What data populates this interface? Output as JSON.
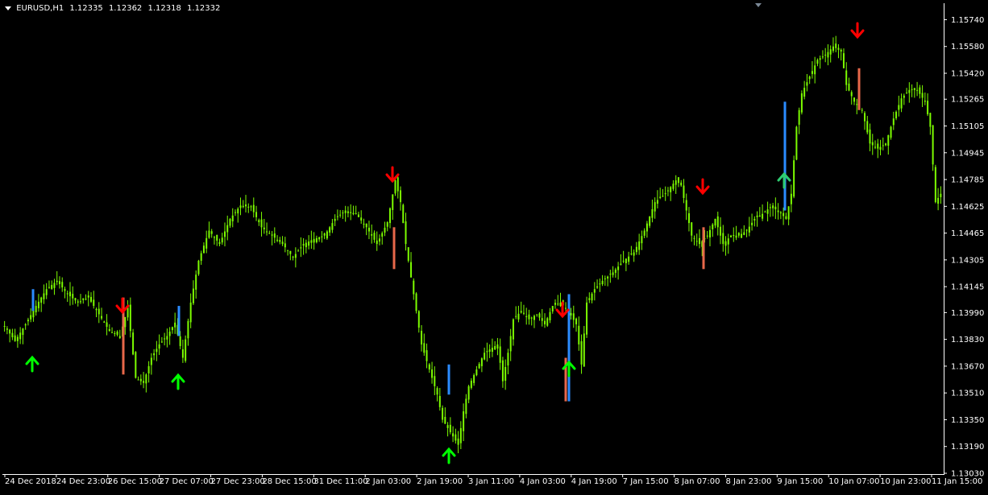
{
  "header": {
    "symbol_timeframe": "EURUSD,H1",
    "quotes": [
      "1.12335",
      "1.12362",
      "1.12318",
      "1.12332"
    ]
  },
  "colors": {
    "background": "#000000",
    "candle": "#7CFC00",
    "axis": "#ffffff",
    "text": "#ffffff",
    "up_arrow": "#00ff00",
    "down_arrow": "#ff0000",
    "bar_red": "#e8684a",
    "bar_blue": "#2b8cff",
    "marker": "#7b8896"
  },
  "chart_data": {
    "type": "candlestick",
    "title": "",
    "xlabel": "",
    "ylabel": "",
    "ylim": [
      1.1303,
      1.158
    ],
    "grid": false,
    "y_ticks": [
      "1.15740",
      "1.15580",
      "1.15420",
      "1.15265",
      "1.15105",
      "1.14945",
      "1.14785",
      "1.14625",
      "1.14465",
      "1.14305",
      "1.14145",
      "1.13990",
      "1.13830",
      "1.13670",
      "1.13510",
      "1.13350",
      "1.13190",
      "1.13030"
    ],
    "x_ticks": [
      "24 Dec 2018",
      "24 Dec 23:00",
      "26 Dec 15:00",
      "27 Dec 07:00",
      "27 Dec 23:00",
      "28 Dec 15:00",
      "31 Dec 11:00",
      "2 Jan 03:00",
      "2 Jan 19:00",
      "3 Jan 11:00",
      "4 Jan 03:00",
      "4 Jan 19:00",
      "7 Jan 15:00",
      "8 Jan 07:00",
      "8 Jan 23:00",
      "9 Jan 15:00",
      "10 Jan 07:00",
      "10 Jan 23:00",
      "11 Jan 15:00"
    ],
    "close_path": [
      [
        0,
        1.1391
      ],
      [
        4,
        1.1382
      ],
      [
        8,
        1.1392
      ],
      [
        12,
        1.1403
      ],
      [
        16,
        1.1413
      ],
      [
        20,
        1.1418
      ],
      [
        24,
        1.141
      ],
      [
        28,
        1.1405
      ],
      [
        32,
        1.1408
      ],
      [
        36,
        1.1398
      ],
      [
        40,
        1.1388
      ],
      [
        44,
        1.1385
      ],
      [
        47,
        1.1402
      ],
      [
        50,
        1.136
      ],
      [
        53,
        1.1357
      ],
      [
        56,
        1.1372
      ],
      [
        59,
        1.138
      ],
      [
        62,
        1.1385
      ],
      [
        65,
        1.1393
      ],
      [
        68,
        1.1372
      ],
      [
        71,
        1.1405
      ],
      [
        74,
        1.143
      ],
      [
        78,
        1.1448
      ],
      [
        82,
        1.144
      ],
      [
        86,
        1.1455
      ],
      [
        90,
        1.1463
      ],
      [
        94,
        1.1462
      ],
      [
        98,
        1.145
      ],
      [
        102,
        1.1445
      ],
      [
        106,
        1.144
      ],
      [
        110,
        1.1432
      ],
      [
        114,
        1.144
      ],
      [
        118,
        1.1443
      ],
      [
        122,
        1.1445
      ],
      [
        126,
        1.1455
      ],
      [
        130,
        1.146
      ],
      [
        134,
        1.1458
      ],
      [
        138,
        1.145
      ],
      [
        142,
        1.144
      ],
      [
        146,
        1.1453
      ],
      [
        149,
        1.1478
      ],
      [
        151,
        1.1465
      ],
      [
        153,
        1.144
      ],
      [
        155,
        1.142
      ],
      [
        157,
        1.14
      ],
      [
        159,
        1.138
      ],
      [
        161,
        1.137
      ],
      [
        163,
        1.136
      ],
      [
        165,
        1.135
      ],
      [
        167,
        1.1335
      ],
      [
        169,
        1.133
      ],
      [
        171,
        1.1325
      ],
      [
        173,
        1.132
      ],
      [
        175,
        1.134
      ],
      [
        177,
        1.1355
      ],
      [
        180,
        1.1365
      ],
      [
        183,
        1.1375
      ],
      [
        186,
        1.1378
      ],
      [
        188,
        1.138
      ],
      [
        190,
        1.1358
      ],
      [
        192,
        1.1375
      ],
      [
        194,
        1.1395
      ],
      [
        197,
        1.14
      ],
      [
        200,
        1.1395
      ],
      [
        203,
        1.1398
      ],
      [
        206,
        1.1392
      ],
      [
        209,
        1.1403
      ],
      [
        212,
        1.1405
      ],
      [
        215,
        1.14
      ],
      [
        218,
        1.1392
      ],
      [
        220,
        1.1368
      ],
      [
        222,
        1.1405
      ],
      [
        225,
        1.1413
      ],
      [
        228,
        1.1418
      ],
      [
        232,
        1.1423
      ],
      [
        236,
        1.143
      ],
      [
        240,
        1.1435
      ],
      [
        244,
        1.1448
      ],
      [
        248,
        1.1465
      ],
      [
        252,
        1.147
      ],
      [
        256,
        1.1478
      ],
      [
        258,
        1.1475
      ],
      [
        260,
        1.146
      ],
      [
        262,
        1.1445
      ],
      [
        265,
        1.144
      ],
      [
        268,
        1.1445
      ],
      [
        271,
        1.1455
      ],
      [
        274,
        1.144
      ],
      [
        277,
        1.1445
      ],
      [
        280,
        1.1445
      ],
      [
        283,
        1.1448
      ],
      [
        286,
        1.1455
      ],
      [
        289,
        1.1458
      ],
      [
        292,
        1.1462
      ],
      [
        295,
        1.146
      ],
      [
        298,
        1.1455
      ],
      [
        300,
        1.147
      ],
      [
        302,
        1.151
      ],
      [
        304,
        1.153
      ],
      [
        307,
        1.154
      ],
      [
        310,
        1.155
      ],
      [
        313,
        1.1553
      ],
      [
        316,
        1.1558
      ],
      [
        319,
        1.1555
      ],
      [
        321,
        1.1535
      ],
      [
        324,
        1.1525
      ],
      [
        327,
        1.152
      ],
      [
        330,
        1.15
      ],
      [
        333,
        1.1497
      ],
      [
        336,
        1.15
      ],
      [
        339,
        1.1515
      ],
      [
        342,
        1.1527
      ],
      [
        345,
        1.1532
      ],
      [
        348,
        1.1532
      ],
      [
        351,
        1.1525
      ],
      [
        353,
        1.151
      ],
      [
        355,
        1.1465
      ],
      [
        357,
        1.147
      ]
    ],
    "up_arrows": [
      8,
      50,
      127,
      260,
      302,
      330
    ],
    "down_arrows": [
      42,
      132,
      205,
      277,
      318
    ],
    "signal_bars": [
      {
        "color": "red",
        "low": 1.1362,
        "high": 1.1408
      },
      {
        "color": "red",
        "low": 1.1425,
        "high": 1.145
      },
      {
        "color": "red",
        "low": 1.1346,
        "high": 1.1372
      },
      {
        "color": "blue",
        "low": 1.1346,
        "high": 1.141
      },
      {
        "color": "red",
        "low": 1.1425,
        "high": 1.145
      },
      {
        "color": "blue",
        "low": 1.146,
        "high": 1.1525
      },
      {
        "color": "red",
        "low": 1.152,
        "high": 1.1545
      },
      {
        "color": "blue",
        "low": 1.14,
        "high": 1.1413
      },
      {
        "color": "blue",
        "low": 1.1385,
        "high": 1.1403
      },
      {
        "color": "blue",
        "low": 1.135,
        "high": 1.1368
      }
    ]
  }
}
